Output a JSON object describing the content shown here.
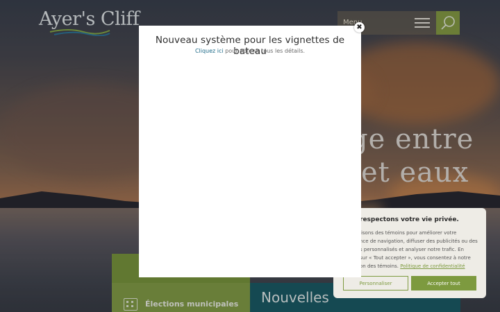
{
  "header": {
    "logo": "Ayer's Cliff",
    "menu_label": "Menu"
  },
  "hero": {
    "line1": "ge entre",
    "line2": "et eaux"
  },
  "tiles": {
    "elections": "Élections municipales",
    "news": "Nouvelles"
  },
  "cookie": {
    "title": "respectons votre vie privée.",
    "text_1": "lisons des témoins pour améliorer votre",
    "text_2": "nce de navigation, diffuser des publicités ou des",
    "text_3": "s personnalisés et analyser notre trafic. En",
    "text_4": "sur « Tout accepter », vous consentez à notre",
    "text_5": "on des témoins.",
    "policy_link": "Politique de confidentialité",
    "customize": "Personnaliser",
    "accept_all": "Accepter tout"
  },
  "modal": {
    "title": "Nouveau système pour les vignettes de bateau",
    "link": "Cliquez ici",
    "subtitle_rest": " pour obtenir tous les détails.",
    "close_glyph": "✖"
  },
  "colors": {
    "brand_green": "#7d9a3f",
    "brand_teal": "#1c5e69",
    "link_blue": "#1d6a88"
  }
}
